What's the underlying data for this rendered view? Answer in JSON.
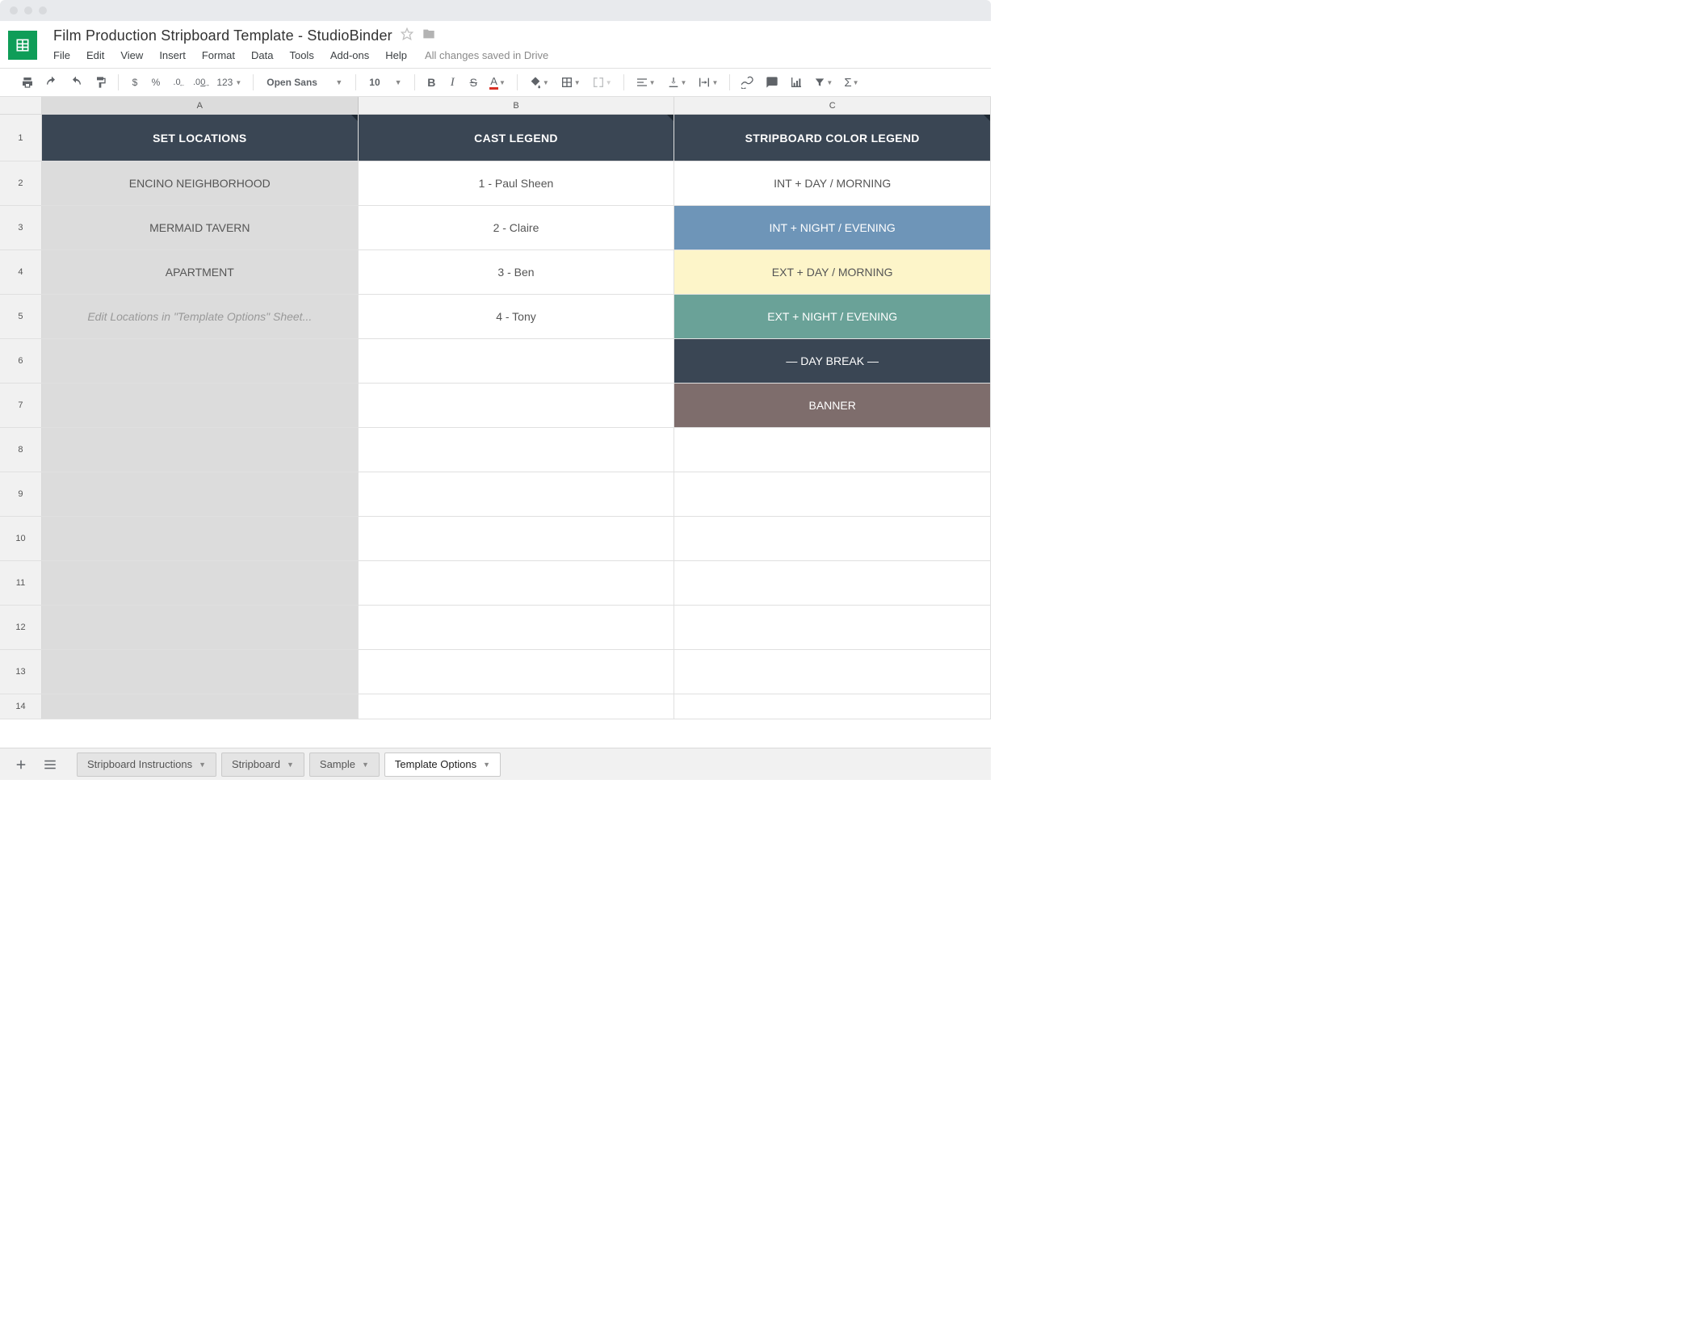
{
  "document": {
    "title": "Film Production Stripboard Template  -  StudioBinder",
    "save_status": "All changes saved in Drive"
  },
  "menu": {
    "file": "File",
    "edit": "Edit",
    "view": "View",
    "insert": "Insert",
    "format": "Format",
    "data": "Data",
    "tools": "Tools",
    "addons": "Add-ons",
    "help": "Help"
  },
  "toolbar": {
    "currency": "$",
    "percent": "%",
    "dec_dec": ".0",
    "inc_dec": ".00",
    "numfmt": "123",
    "font": "Open Sans",
    "fontsize": "10",
    "bold": "B",
    "italic": "I",
    "strike": "S",
    "textcolor": "A"
  },
  "columns": {
    "A": "A",
    "B": "B",
    "C": "C"
  },
  "rows": [
    "1",
    "2",
    "3",
    "4",
    "5",
    "6",
    "7",
    "8",
    "9",
    "10",
    "11",
    "12",
    "13",
    "14"
  ],
  "table": {
    "headers": {
      "a": "SET LOCATIONS",
      "b": "CAST LEGEND",
      "c": "STRIPBOARD COLOR LEGEND"
    },
    "colA": {
      "r2": "ENCINO NEIGHBORHOOD",
      "r3": "MERMAID TAVERN",
      "r4": "APARTMENT",
      "r5": "Edit Locations in \"Template Options\" Sheet..."
    },
    "colB": {
      "r2": "1 - Paul Sheen",
      "r3": "2 - Claire",
      "r4": "3 - Ben",
      "r5": "4 - Tony"
    },
    "colC": {
      "r2": "INT  +  DAY / MORNING",
      "r3": "INT  +  NIGHT / EVENING",
      "r4": "EXT  +  DAY / MORNING",
      "r5": "EXT  +  NIGHT / EVENING",
      "r6": "— DAY BREAK —",
      "r7": "BANNER"
    }
  },
  "tabs": {
    "t1": "Stripboard Instructions",
    "t2": "Stripboard",
    "t3": "Sample",
    "t4": "Template Options"
  },
  "colors": {
    "header_row": "#3a4654",
    "int_night": "#6e95b8",
    "ext_day": "#fdf5c9",
    "ext_night": "#6aa298",
    "daybreak": "#3a4654",
    "banner": "#7e6d6c"
  }
}
